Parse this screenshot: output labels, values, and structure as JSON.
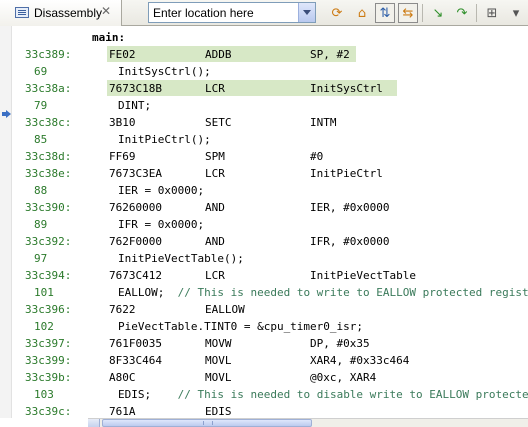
{
  "tab": {
    "label": "Disassembly",
    "close_icon": "close-icon"
  },
  "location": {
    "placeholder": "Enter location here"
  },
  "toolbar": {
    "icons": [
      "go-to-address-icon",
      "home-pc-icon",
      "show-source-icon",
      "sync-source-icon",
      "step-into-icon",
      "step-over-icon",
      "new-view-icon",
      "view-menu-icon"
    ]
  },
  "colors": {
    "address": "#2b7a2b",
    "highlight": "#d7e8c6",
    "comment": "#3a7a5a"
  },
  "code": {
    "label_main": "main:",
    "r1_addr": "33c389:",
    "r1_op": "FE02",
    "r1_mn": "ADDB",
    "r1_arg": "SP, #2",
    "r2_line": "69",
    "r2_src": "InitSysCtrl();",
    "r3_addr": "33c38a:",
    "r3_op": "7673C18B",
    "r3_mn": "LCR",
    "r3_arg": "InitSysCtrl",
    "r4_line": "79",
    "r4_src": "DINT;",
    "r5_addr": "33c38c:",
    "r5_op": "3B10",
    "r5_mn": "SETC",
    "r5_arg": "INTM",
    "r6_line": "85",
    "r6_src": "InitPieCtrl();",
    "r7_addr": "33c38d:",
    "r7_op": "FF69",
    "r7_mn": "SPM",
    "r7_arg": "#0",
    "r8_addr": "33c38e:",
    "r8_op": "7673C3EA",
    "r8_mn": "LCR",
    "r8_arg": "InitPieCtrl",
    "r9_line": "88",
    "r9_src": "IER = 0x0000;",
    "r10_addr": "33c390:",
    "r10_op": "76260000",
    "r10_mn": "AND",
    "r10_arg": "IER, #0x0000",
    "r11_line": "89",
    "r11_src": "IFR = 0x0000;",
    "r12_addr": "33c392:",
    "r12_op": "762F0000",
    "r12_mn": "AND",
    "r12_arg": "IFR, #0x0000",
    "r13_line": "97",
    "r13_src": "InitPieVectTable();",
    "r14_addr": "33c394:",
    "r14_op": "7673C412",
    "r14_mn": "LCR",
    "r14_arg": "InitPieVectTable",
    "r15_line": "101",
    "r15_src": "EALLOW;",
    "r15_cmt": "// This is needed to write to EALLOW protected registers",
    "r16_addr": "33c396:",
    "r16_op": "7622",
    "r16_mn": "EALLOW",
    "r17_line": "102",
    "r17_src": "PieVectTable.TINT0 = &cpu_timer0_isr;",
    "r18_addr": "33c397:",
    "r18_op": "761F0035",
    "r18_mn": "MOVW",
    "r18_arg": "DP, #0x35",
    "r19_addr": "33c399:",
    "r19_op": "8F33C464",
    "r19_mn": "MOVL",
    "r19_arg": "XAR4, #0x33c464",
    "r20_addr": "33c39b:",
    "r20_op": "A80C",
    "r20_mn": "MOVL",
    "r20_arg": "@0xc, XAR4",
    "r21_line": "103",
    "r21_src": "EDIS;",
    "r21_cmt": "// This is needed to disable write to EALLOW protected registers",
    "r22_addr": "33c39c:",
    "r22_op": "761A",
    "r22_mn": "EDIS"
  }
}
